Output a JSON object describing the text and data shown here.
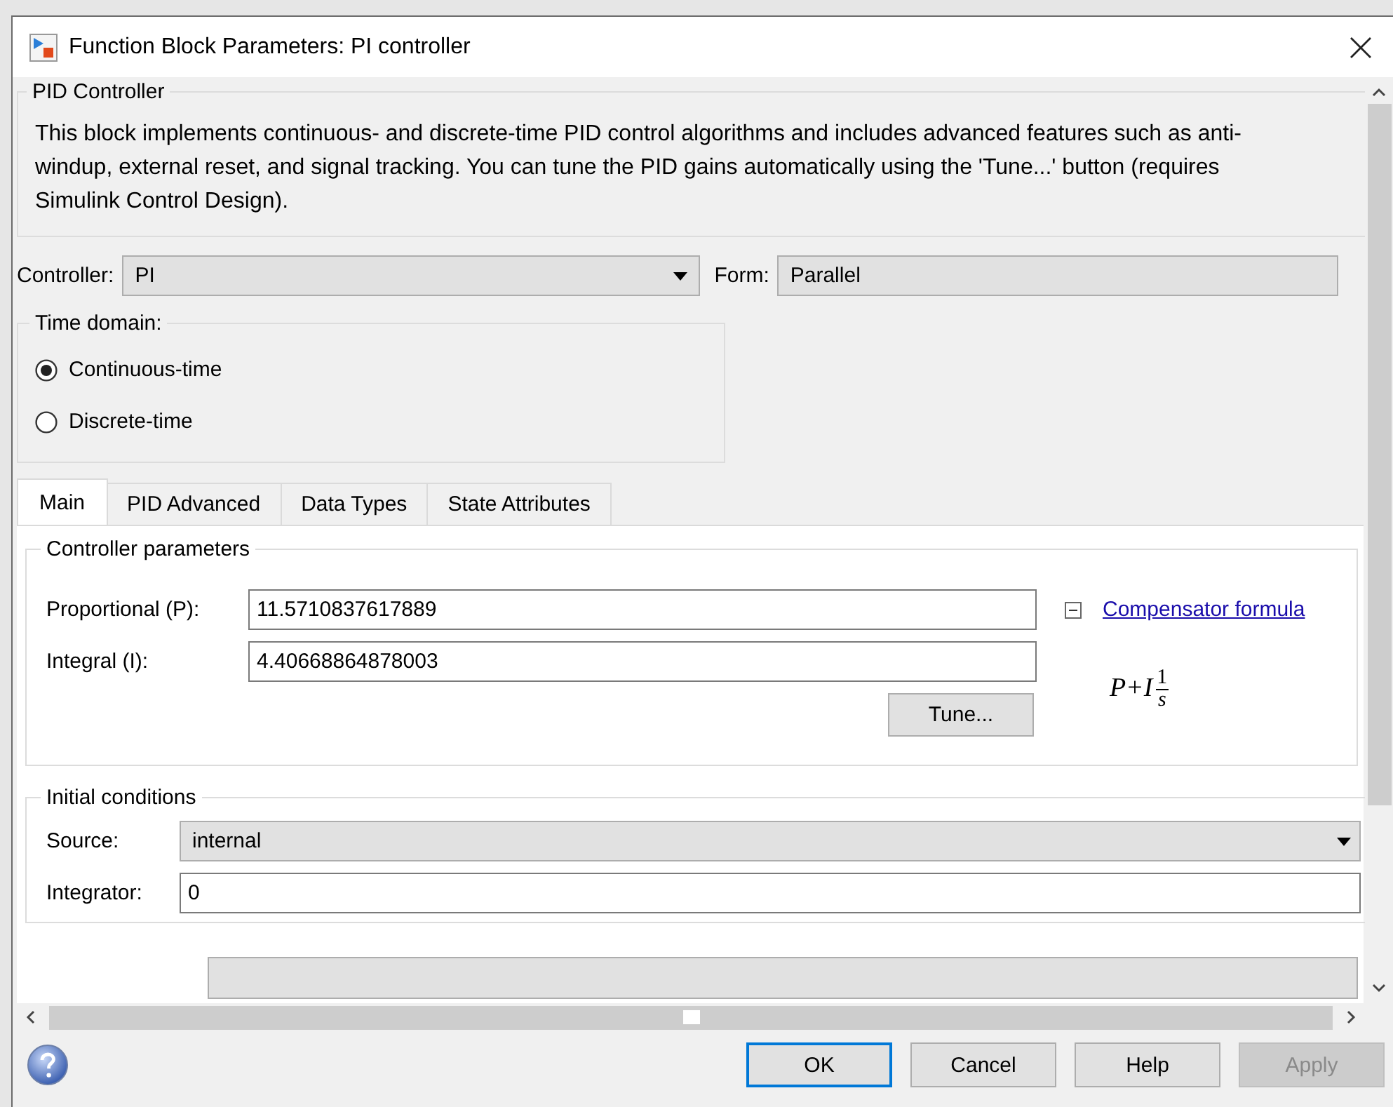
{
  "window": {
    "title": "Function Block Parameters: PI controller"
  },
  "description_group": {
    "title": "PID Controller",
    "text": "This block implements continuous- and discrete-time PID control algorithms and includes advanced features such as anti-windup, external reset, and signal tracking. You can tune the PID gains automatically using the 'Tune...' button (requires Simulink Control Design)."
  },
  "controller": {
    "label": "Controller:",
    "value": "PI"
  },
  "form": {
    "label": "Form:",
    "value": "Parallel"
  },
  "time_domain": {
    "title": "Time domain:",
    "options": [
      {
        "label": "Continuous-time",
        "selected": true
      },
      {
        "label": "Discrete-time",
        "selected": false
      }
    ]
  },
  "tabs": [
    {
      "label": "Main",
      "selected": true
    },
    {
      "label": "PID Advanced",
      "selected": false
    },
    {
      "label": "Data Types",
      "selected": false
    },
    {
      "label": "State Attributes",
      "selected": false
    }
  ],
  "controller_parameters": {
    "title": "Controller parameters",
    "fields": [
      {
        "label": "Proportional (P):",
        "value": "11.5710837617889"
      },
      {
        "label": "Integral (I):",
        "value": "4.40668864878003"
      }
    ],
    "tune_button": "Tune...",
    "formula_link": {
      "label": "Compensator formula",
      "expanded": true
    },
    "formula": {
      "term_1": "P",
      "operator": "+",
      "term_2": "I",
      "numerator": "1",
      "denominator": "s"
    }
  },
  "initial_conditions": {
    "title": "Initial conditions",
    "source": {
      "label": "Source:",
      "value": "internal"
    },
    "integrator": {
      "label": "Integrator:",
      "value": "0"
    }
  },
  "buttons": [
    {
      "label": "OK",
      "focused": true,
      "disabled": false
    },
    {
      "label": "Cancel",
      "focused": false,
      "disabled": false
    },
    {
      "label": "Help",
      "focused": false,
      "disabled": false
    },
    {
      "label": "Apply",
      "focused": false,
      "disabled": true
    }
  ]
}
